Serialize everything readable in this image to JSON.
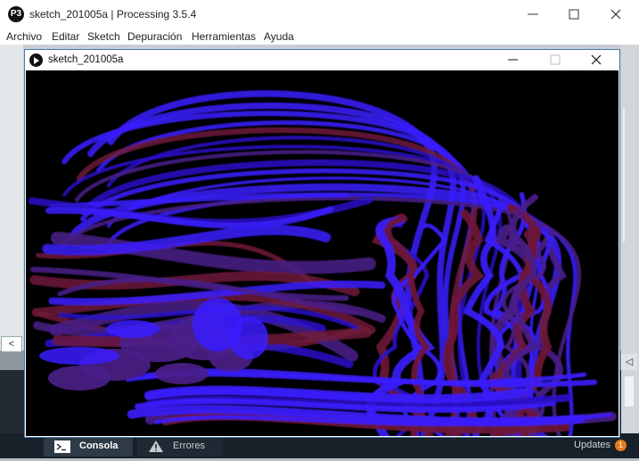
{
  "ide": {
    "title": "sketch_201005a | Processing 3.5.4",
    "logo_glyph": "P3",
    "menu": [
      "Archivo",
      "Editar",
      "Sketch",
      "Depuración",
      "Herramientas",
      "Ayuda"
    ],
    "window_controls": [
      "minimize-icon",
      "maximize-icon",
      "close-icon"
    ]
  },
  "sketch_window": {
    "title": "sketch_201005a",
    "icon": "play-icon",
    "window_controls": [
      "minimize-icon",
      "maximize-icon",
      "close-icon"
    ]
  },
  "footer": {
    "tabs": [
      {
        "label": "Consola",
        "icon": "console-icon",
        "active": true
      },
      {
        "label": "Errores",
        "icon": "warning-icon",
        "active": false
      }
    ],
    "updates_label": "Updates",
    "updates_count": "1"
  },
  "editor": {
    "scroll_left_glyph": "<",
    "scroll_right_glyph": "◁"
  },
  "colors": {
    "canvas_background": "#000000",
    "stroke_blue": "#3a1cff",
    "stroke_indigo": "#2c12c8",
    "stroke_purple": "#4a1f8a",
    "stroke_maroon": "#6e1a38",
    "badge_orange": "#e27c1d"
  }
}
